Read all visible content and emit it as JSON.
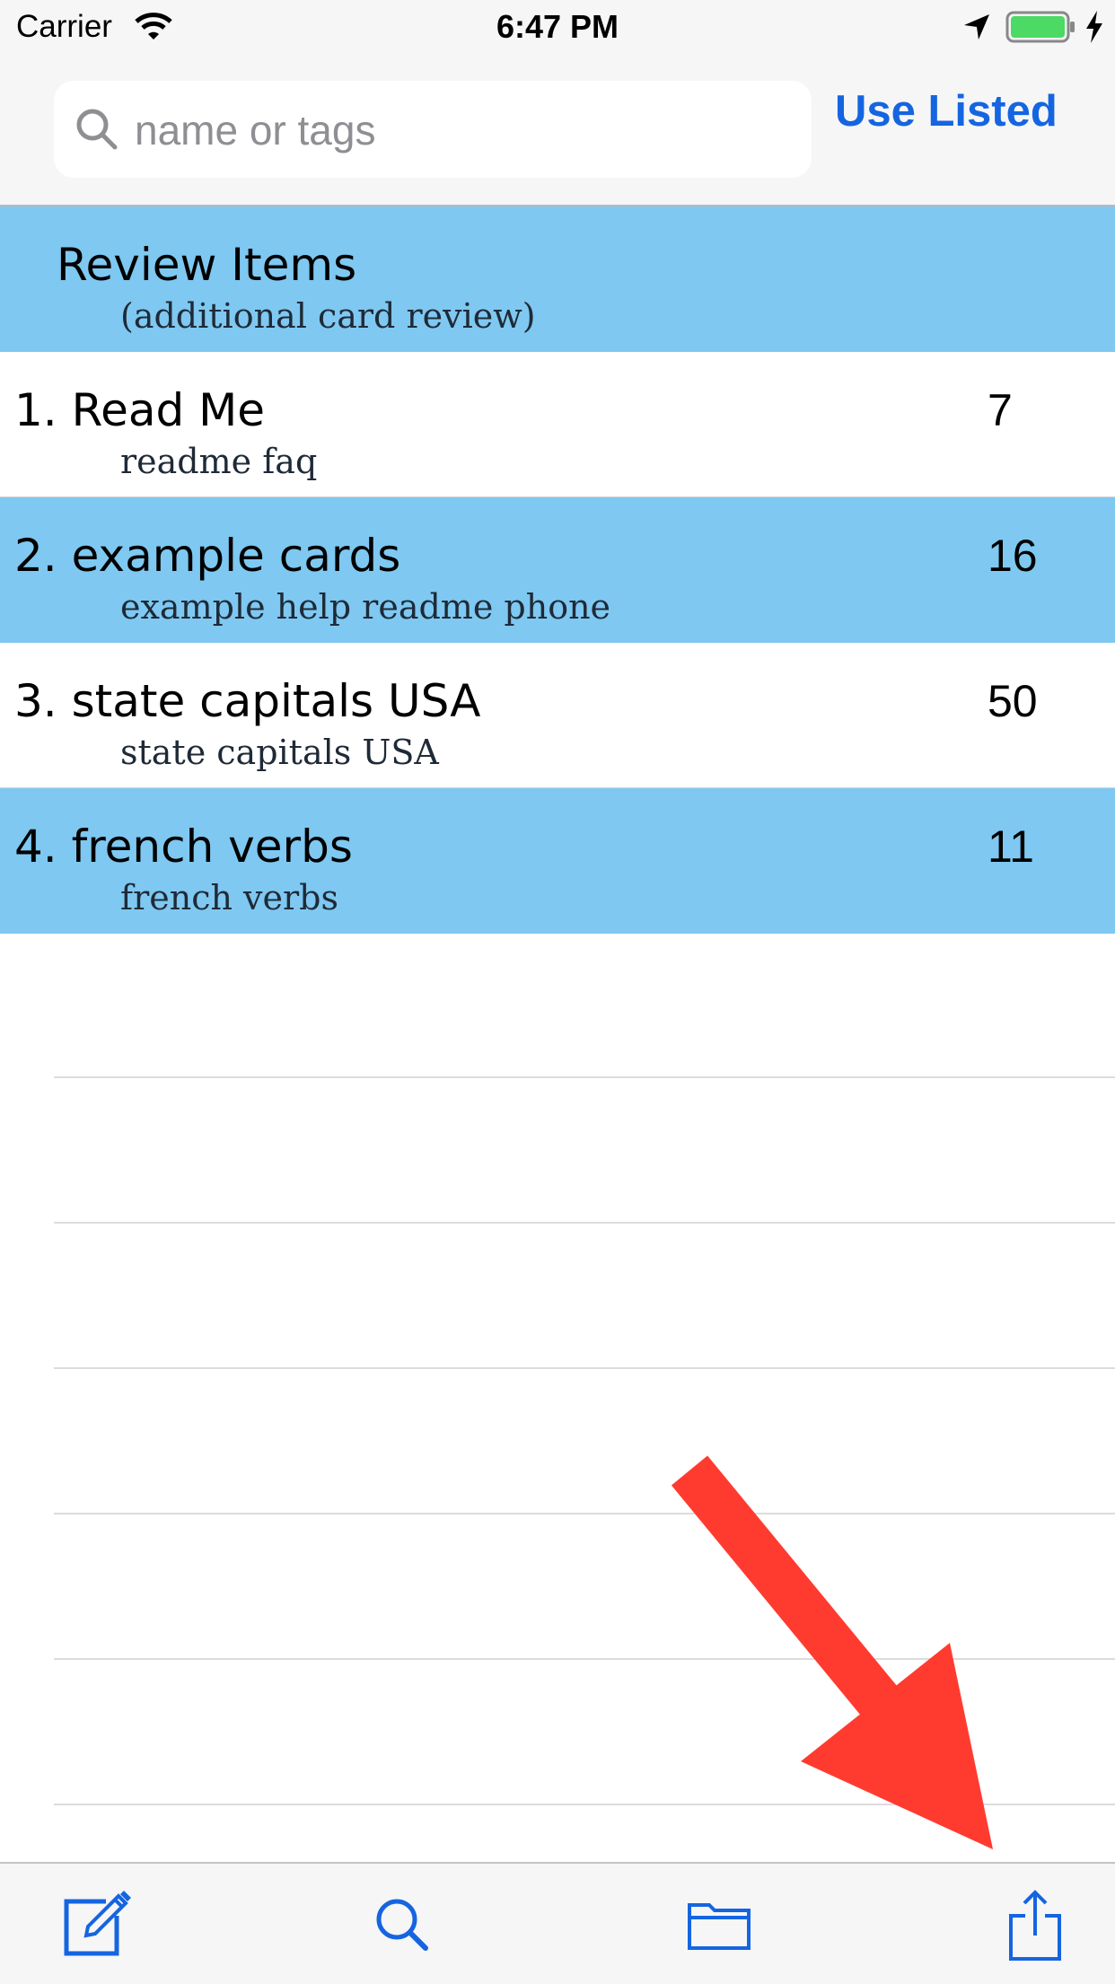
{
  "status_bar": {
    "carrier": "Carrier",
    "time": "6:47 PM",
    "battery_color": "#4cd964"
  },
  "search": {
    "placeholder": "name or tags",
    "value": "",
    "use_listed_label": "Use Listed"
  },
  "review": {
    "title": "Review Items",
    "subtitle": "(additional card review)"
  },
  "decks": [
    {
      "title": "1. Read Me",
      "tags": "readme faq",
      "count": "7"
    },
    {
      "title": "2. example cards",
      "tags": "example help readme phone",
      "count": "16"
    },
    {
      "title": "3. state capitals USA",
      "tags": "state capitals USA",
      "count": "50"
    },
    {
      "title": "4. french verbs",
      "tags": "french verbs",
      "count": "11"
    }
  ],
  "toolbar": {
    "items": [
      "compose-icon",
      "search-icon",
      "folder-icon",
      "share-icon"
    ]
  },
  "colors": {
    "accent": "#1565e0",
    "row_highlight": "#7ec8f1",
    "annotation_arrow": "#ff3b30"
  }
}
